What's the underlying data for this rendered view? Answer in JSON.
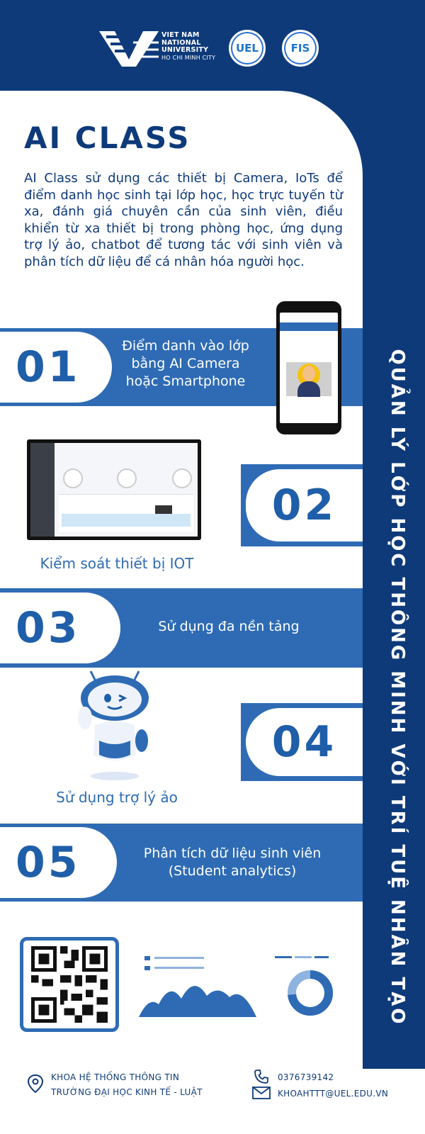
{
  "header": {
    "vnu_lines": [
      "VIET NAM",
      "NATIONAL",
      "UNIVERSITY",
      "HO CHI MINH CITY"
    ],
    "uel_label": "UEL",
    "fis_label": "FIS"
  },
  "title": "AI CLASS",
  "intro": "AI Class sử dụng các thiết bị Camera, IoTs để điểm danh học sinh tại lớp học, học trực tuyến từ xa, đánh giá chuyên cần của sinh viên, điều khiển từ xa thiết bị trong phòng học, ứng dụng trợ lý ảo, chatbot để tương tác với sinh viên và phân tích dữ liệu để cá nhân hóa người học.",
  "side_title": "QUẢN LÝ LỚP HỌC THÔNG MINH VỚI TRÍ TUỆ NHÂN TẠO",
  "items": [
    {
      "number": "01",
      "label": "Điểm danh vào lớp bằng AI Camera hoặc Smartphone"
    },
    {
      "number": "02",
      "label": "Kiểm soát thiết bị IOT"
    },
    {
      "number": "03",
      "label": "Sử dụng đa nền tảng"
    },
    {
      "number": "04",
      "label": "Sử dụng trợ lý ảo"
    },
    {
      "number": "05",
      "label": "Phân tích dữ liệu sinh viên\n(Student analytics)"
    }
  ],
  "footer": {
    "address_line1": "KHOA HỆ THỐNG THÔNG TIN",
    "address_line2": "TRƯỜNG ĐẠI HỌC KINH TẾ - LUẬT",
    "phone": "0376739142",
    "email": "KHOAHTTT@UEL.EDU.VN"
  },
  "colors": {
    "navy": "#0e3a7a",
    "band_blue": "#2e6bb4",
    "accent": "#1f5ea8"
  }
}
